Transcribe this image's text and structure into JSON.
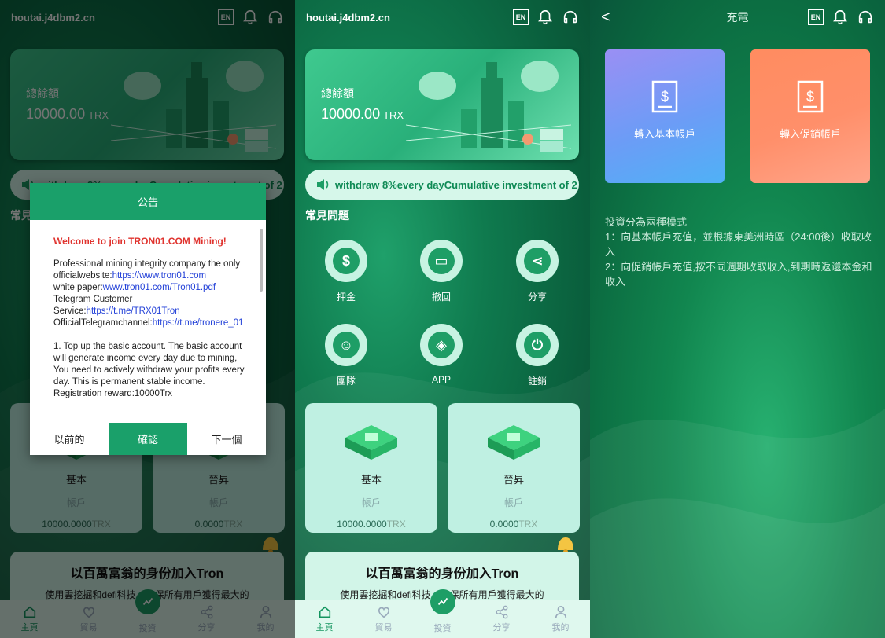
{
  "site_title": "houtai.j4dbm2.cn",
  "en_label": "EN",
  "balance": {
    "label": "總餘額",
    "value": "10000.00",
    "unit": "TRX"
  },
  "marquee": "withdraw 8%every dayCumulative investment of 2",
  "faq_title": "常見問題",
  "faq_items": [
    {
      "label": "押金",
      "icon": "moneybag-icon"
    },
    {
      "label": "撤回",
      "icon": "card-icon"
    },
    {
      "label": "分享",
      "icon": "share-icon"
    },
    {
      "label": "團隊",
      "icon": "team-icon"
    },
    {
      "label": "APP",
      "icon": "cube-icon"
    },
    {
      "label": "註銷",
      "icon": "power-icon"
    }
  ],
  "accounts": [
    {
      "name": "基本",
      "sub": "帳戶",
      "value": "10000.0000",
      "unit": "TRX"
    },
    {
      "name": "晉昇",
      "sub": "帳戶",
      "value": "0.0000",
      "unit": "TRX"
    }
  ],
  "promo": {
    "title": "以百萬富翁的身份加入Tron",
    "desc": "使用雲挖掘和defi科技，確保所有用戶獲得最大的"
  },
  "nav": [
    {
      "label": "主頁",
      "icon": "home-icon"
    },
    {
      "label": "貿易",
      "icon": "heart-icon"
    },
    {
      "label": "投資",
      "icon": "chart-icon"
    },
    {
      "label": "分享",
      "icon": "share-icon"
    },
    {
      "label": "我的",
      "icon": "user-icon"
    }
  ],
  "modal": {
    "title": "公告",
    "welcome": "Welcome to join TRON01.COM Mining!",
    "line1": "Professional mining integrity company the only",
    "line2_prefix": "officialwebsite:",
    "line2_link": "https://www.tron01.com",
    "line3_prefix": "white paper:",
    "line3_link": "www.tron01.com/Tron01.pdf",
    "line4": "Telegram Customer",
    "line5_prefix": "Service:",
    "line5_link": "https://t.me/TRX01Tron",
    "line6_prefix": "OfficialTelegramchannel:",
    "line6_link": "https://t.me/tronere_01",
    "para2": "1. Top up the basic account. The basic account will generate income every day due to mining, You need to actively withdraw your profits every day. This is permanent stable income.",
    "line_reg": "Registration  reward:10000Trx",
    "btn_prev": "以前的",
    "btn_confirm": "確認",
    "btn_next": "下一個"
  },
  "recharge": {
    "title": "充電",
    "back_label": "<",
    "card_basic": "轉入基本帳戶",
    "card_promo": "轉入促銷帳戶",
    "info_1": "投資分為兩種模式",
    "info_2": "1：向基本帳戶充值，並根據東美洲時區（24:00後）收取收入",
    "info_3": "2：向促銷帳戶充值,按不同週期收取收入,到期時返還本金和收入"
  }
}
